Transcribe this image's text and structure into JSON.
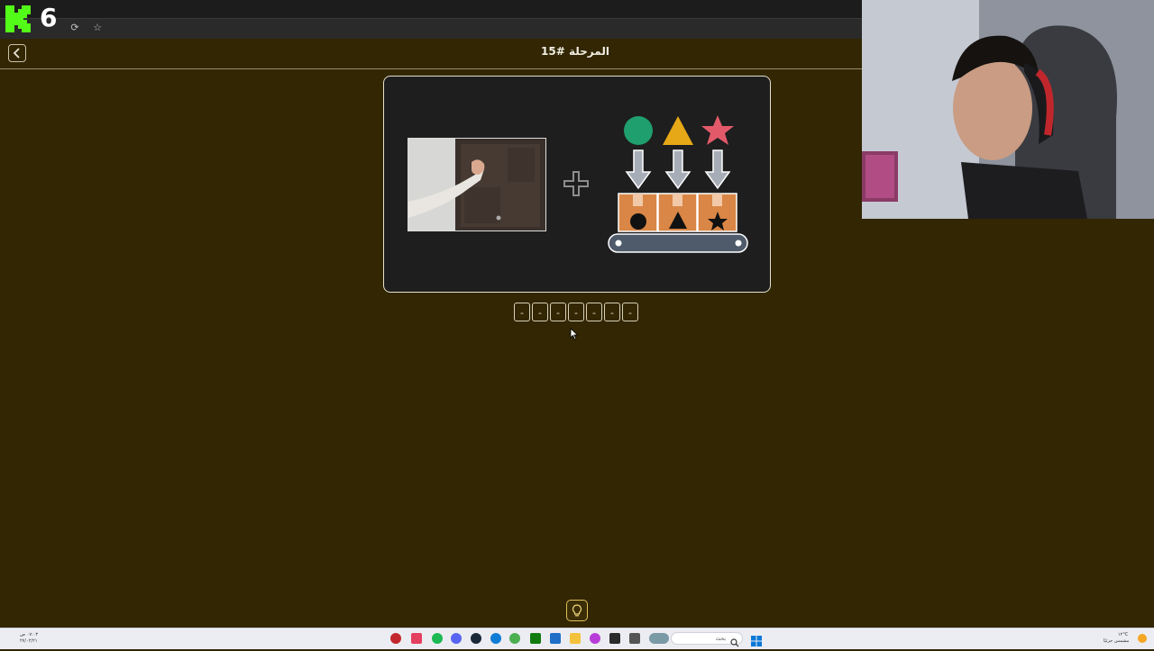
{
  "overlay": {
    "logo_number": "6"
  },
  "header": {
    "level_title": "المرحلة #15"
  },
  "puzzle": {
    "shape_colors": {
      "circle": "#1f9e6e",
      "triangle": "#e6a817",
      "star": "#e25a6a",
      "box": "#d98646",
      "belt": "#4f5b6a"
    }
  },
  "answer": {
    "slots": [
      "-",
      "-",
      "-",
      "-",
      "-",
      "-",
      "-"
    ]
  },
  "colors": {
    "background": "#322603",
    "card": "#1e1e1e",
    "accent": "#e0c15a"
  },
  "taskbar": {
    "search_placeholder": "بحث",
    "weather_temp": "١٢°C",
    "weather_desc": "مشمس جزئيًا",
    "clock_time": "٠٧:٠٣ ص",
    "clock_date": "٢٧/٠٢/٢١"
  }
}
